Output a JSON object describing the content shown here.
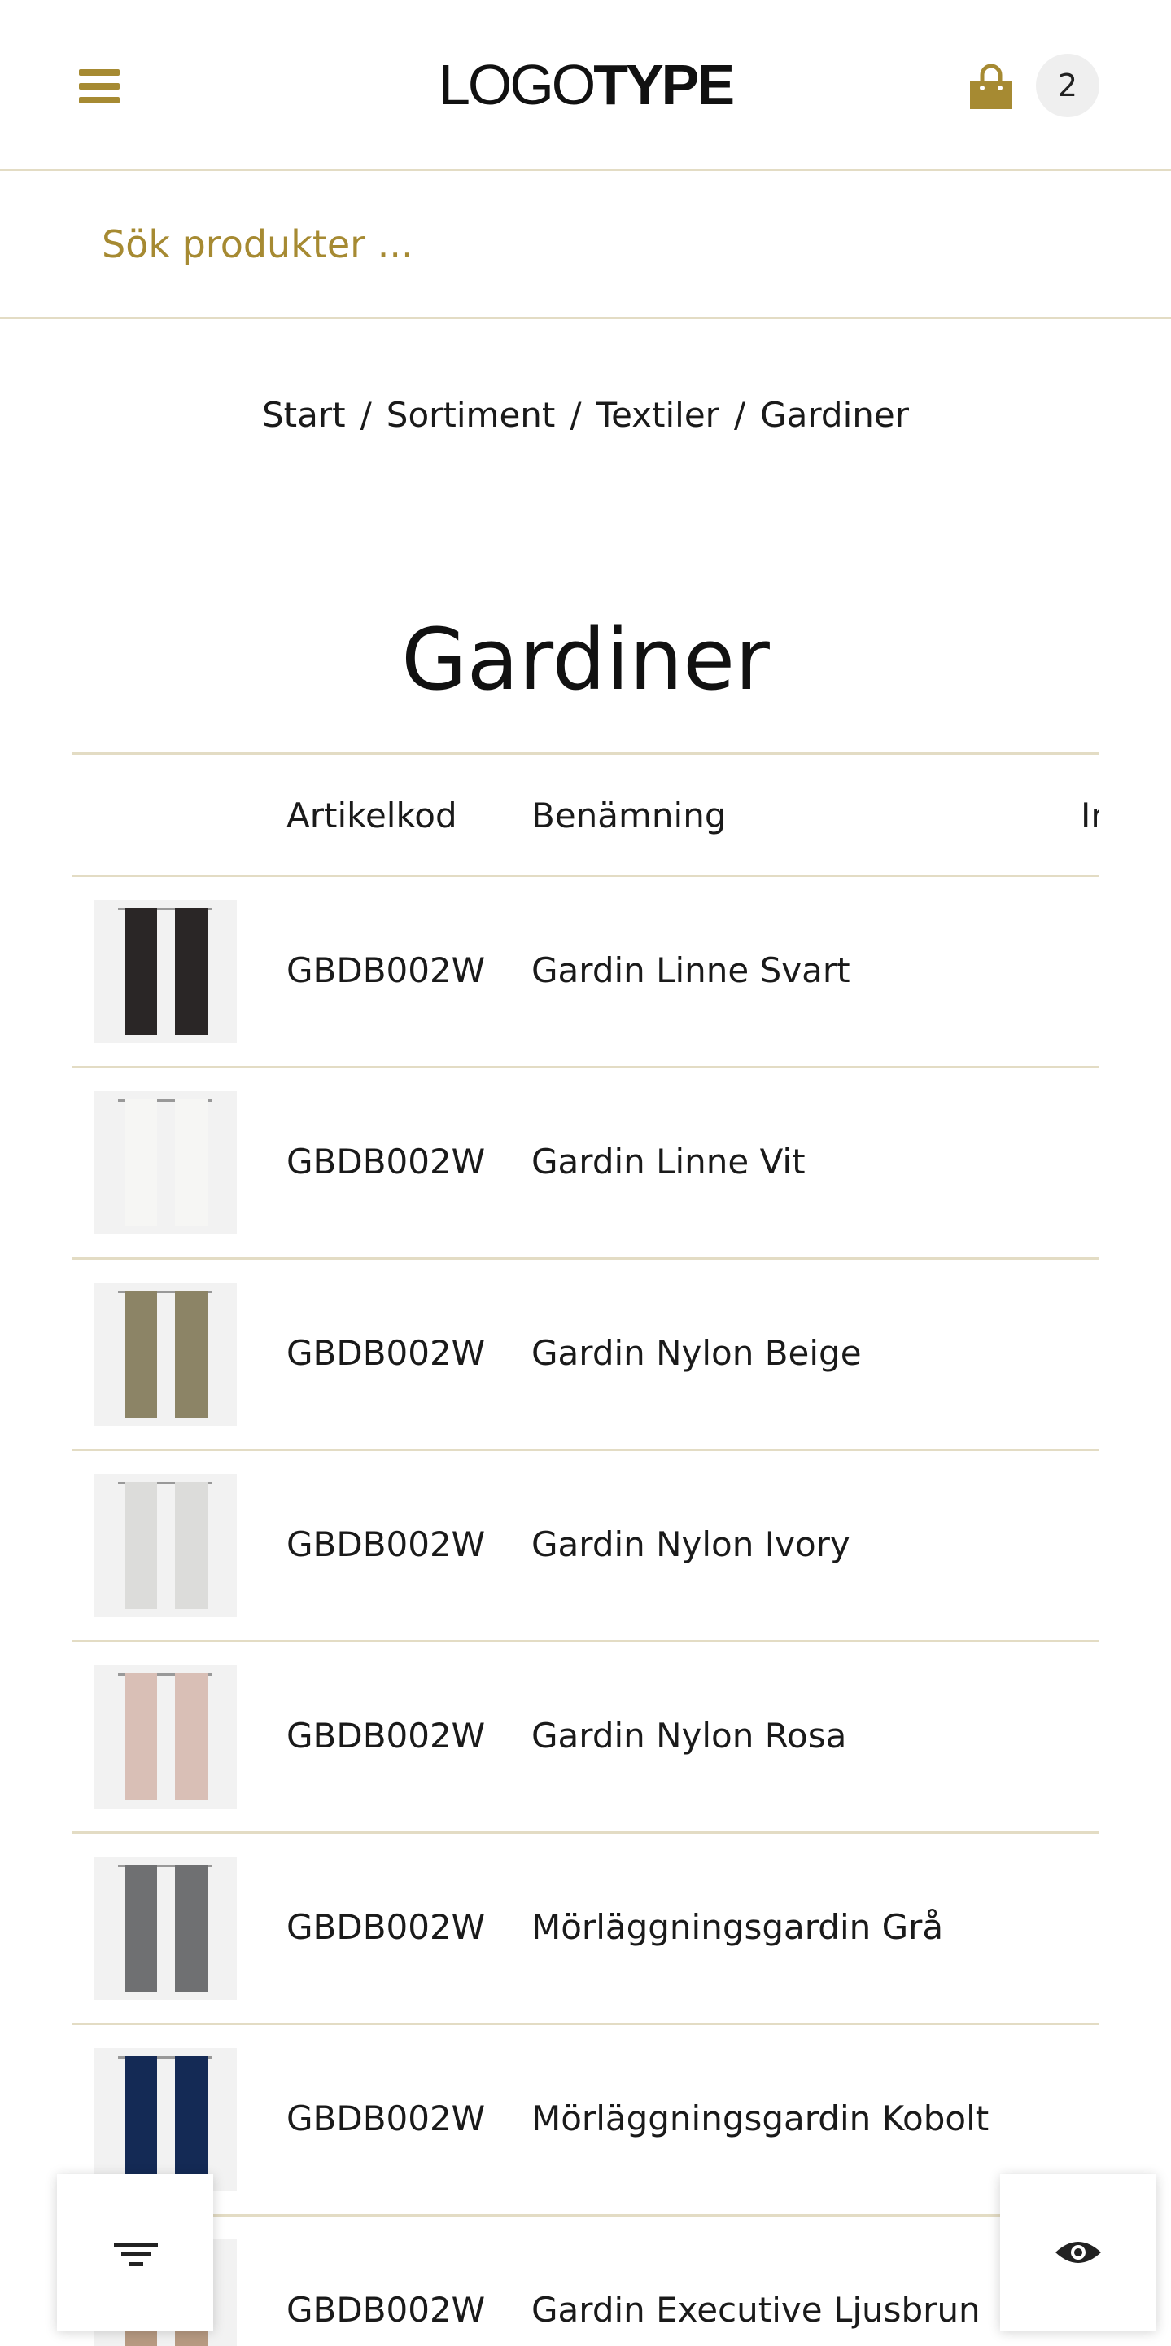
{
  "header": {
    "logo_light": "LOGO",
    "logo_bold": "TYPE",
    "menu_icon": "hamburger-menu-icon",
    "cart_icon": "shopping-bag-icon",
    "cart_count": "2",
    "accent_color": "#a68a32"
  },
  "search": {
    "placeholder": "Sök produkter ..."
  },
  "breadcrumb": {
    "items": [
      "Start",
      "Sortiment",
      "Textiler",
      "Gardiner"
    ],
    "separator": "/"
  },
  "page_title": "Gardiner",
  "table": {
    "columns": [
      "",
      "Artikelkod",
      "Benämning",
      "In"
    ],
    "rows": [
      {
        "code": "GBDB002W",
        "name": "Gardin Linne Svart",
        "color": "#2a2626"
      },
      {
        "code": "GBDB002W",
        "name": "Gardin Linne Vit",
        "color": "#f6f6f4"
      },
      {
        "code": "GBDB002W",
        "name": "Gardin Nylon Beige",
        "color": "#8c8466"
      },
      {
        "code": "GBDB002W",
        "name": "Gardin Nylon Ivory",
        "color": "#dcdcda"
      },
      {
        "code": "GBDB002W",
        "name": "Gardin Nylon Rosa",
        "color": "#d9bfb6"
      },
      {
        "code": "GBDB002W",
        "name": "Mörläggningsgardin Grå",
        "color": "#6f7072"
      },
      {
        "code": "GBDB002W",
        "name": "Mörläggningsgardin Kobolt",
        "color": "#142a55"
      },
      {
        "code": "GBDB002W",
        "name": "Gardin Executive Ljusbrun",
        "color": "#b79a82"
      }
    ]
  },
  "fabs": {
    "filter_icon": "filter-icon",
    "view_icon": "eye-icon"
  }
}
